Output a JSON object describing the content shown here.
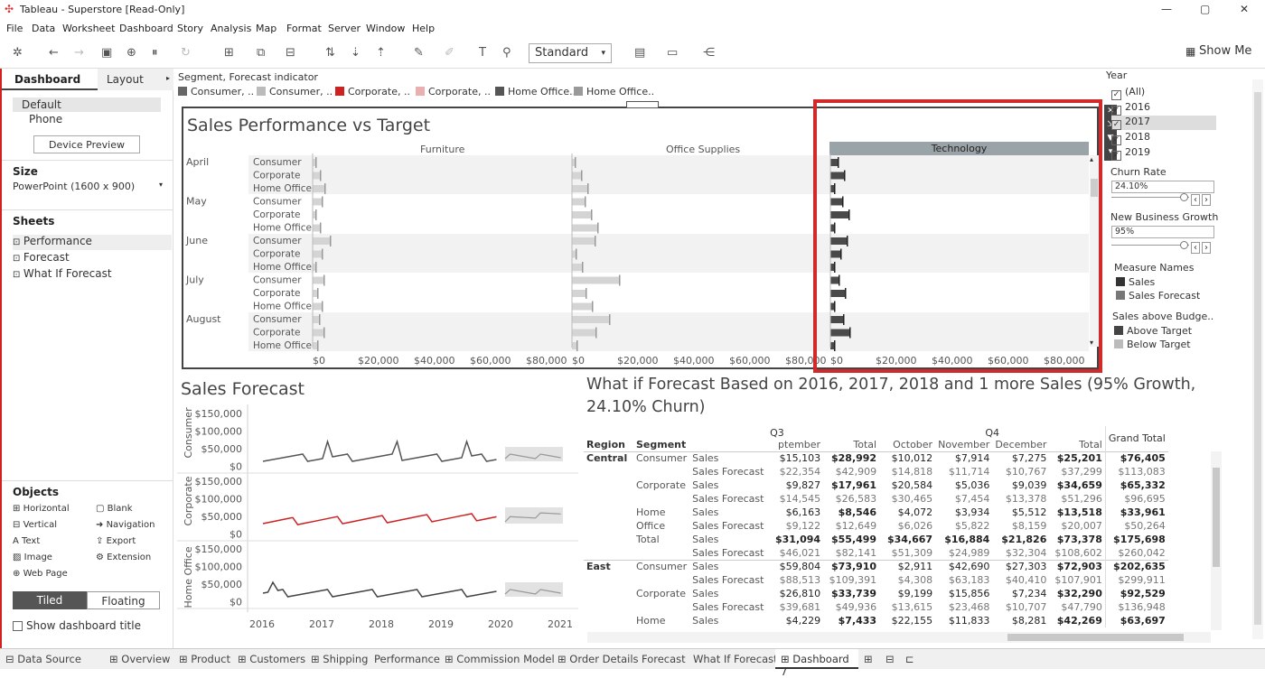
{
  "window": {
    "title": "Tableau - Superstore [Read-Only]"
  },
  "menu": [
    "File",
    "Data",
    "Worksheet",
    "Dashboard",
    "Story",
    "Analysis",
    "Map",
    "Format",
    "Server",
    "Window",
    "Help"
  ],
  "toolbar": {
    "fit": "Standard",
    "show_me": "Show Me"
  },
  "left": {
    "tab_dashboard": "Dashboard",
    "tab_layout": "Layout",
    "device_default": "Default",
    "device_phone": "Phone",
    "device_preview": "Device Preview",
    "size_header": "Size",
    "size_value": "PowerPoint (1600 x 900)",
    "sheets_header": "Sheets",
    "sheets": [
      "Performance",
      "Forecast",
      "What If Forecast"
    ],
    "objects_header": "Objects",
    "objects": [
      "Horizontal",
      "Blank",
      "Vertical",
      "Navigation",
      "Text",
      "Export",
      "Image",
      "Extension",
      "Web Page"
    ],
    "tiled": "Tiled",
    "floating": "Floating",
    "show_title": "Show dashboard title"
  },
  "legend_top": {
    "title": "Segment, Forecast indicator",
    "items": [
      "Consumer, ..",
      "Consumer, ..",
      "Corporate, ..",
      "Corporate, ..",
      "Home Office..",
      "Home Office.."
    ],
    "colors": [
      "#666666",
      "#bbbbbb",
      "#cc2222",
      "#e8b0b0",
      "#555555",
      "#999999"
    ]
  },
  "perf": {
    "title": "Sales Performance vs Target",
    "categories": [
      "Furniture",
      "Office Supplies",
      "Technology"
    ],
    "months": [
      "April",
      "May",
      "June",
      "July",
      "August"
    ],
    "segments": [
      "Consumer",
      "Corporate",
      "Home Office"
    ],
    "ticks": [
      "$0",
      "$20,000",
      "$40,000",
      "$60,000",
      "$80,000"
    ]
  },
  "forecast": {
    "title": "Sales Forecast",
    "rows": [
      "Consumer",
      "Corporate",
      "Home Office"
    ],
    "yticks": [
      "$150,000",
      "$100,000",
      "$50,000",
      "$0"
    ],
    "years": [
      "2016",
      "2017",
      "2018",
      "2019",
      "2020",
      "2021"
    ]
  },
  "whatif": {
    "title1": "What if Forecast Based on 2016, 2017, 2018 and 1 more Sales (95% Growth,",
    "title2": "24.10% Churn)",
    "q3": "Q3",
    "q4": "Q4",
    "grand_total": "Grand Total",
    "h_region": "Region",
    "h_segment": "Segment",
    "cols": [
      "ptember",
      "Total",
      "October",
      "November",
      "December",
      "Total"
    ],
    "rows": [
      [
        "Central",
        "Consumer",
        "Sales",
        "$15,103",
        "$28,992",
        "$10,012",
        "$7,914",
        "$7,275",
        "$25,201",
        "$76,405"
      ],
      [
        "",
        "",
        "Sales Forecast",
        "$22,354",
        "$42,909",
        "$14,818",
        "$11,714",
        "$10,767",
        "$37,299",
        "$113,083"
      ],
      [
        "",
        "Corporate",
        "Sales",
        "$9,827",
        "$17,961",
        "$20,584",
        "$5,036",
        "$9,039",
        "$34,659",
        "$65,332"
      ],
      [
        "",
        "",
        "Sales Forecast",
        "$14,545",
        "$26,583",
        "$30,465",
        "$7,454",
        "$13,378",
        "$51,296",
        "$96,695"
      ],
      [
        "",
        "Home",
        "Sales",
        "$6,163",
        "$8,546",
        "$4,072",
        "$3,934",
        "$5,512",
        "$13,518",
        "$33,961"
      ],
      [
        "",
        "Office",
        "Sales Forecast",
        "$9,122",
        "$12,649",
        "$6,026",
        "$5,822",
        "$8,159",
        "$20,007",
        "$50,264"
      ],
      [
        "",
        "Total",
        "Sales",
        "$31,094",
        "$55,499",
        "$34,667",
        "$16,884",
        "$21,826",
        "$73,378",
        "$175,698"
      ],
      [
        "",
        "",
        "Sales Forecast",
        "$46,021",
        "$82,141",
        "$51,309",
        "$24,989",
        "$32,304",
        "$108,602",
        "$260,042"
      ],
      [
        "East",
        "Consumer",
        "Sales",
        "$59,804",
        "$73,910",
        "$2,911",
        "$42,690",
        "$27,303",
        "$72,903",
        "$202,635"
      ],
      [
        "",
        "",
        "Sales Forecast",
        "$88,513",
        "$109,391",
        "$4,308",
        "$63,183",
        "$40,410",
        "$107,901",
        "$299,911"
      ],
      [
        "",
        "Corporate",
        "Sales",
        "$26,810",
        "$33,739",
        "$9,199",
        "$15,856",
        "$7,234",
        "$32,290",
        "$92,529"
      ],
      [
        "",
        "",
        "Sales Forecast",
        "$39,681",
        "$49,936",
        "$13,615",
        "$23,468",
        "$10,707",
        "$47,790",
        "$136,948"
      ],
      [
        "",
        "Home",
        "Sales",
        "$4,229",
        "$7,433",
        "$22,155",
        "$11,833",
        "$8,281",
        "$42,269",
        "$63,697"
      ]
    ]
  },
  "right": {
    "year_title": "Year",
    "years": [
      "(All)",
      "2016",
      "2017",
      "2018",
      "2019"
    ],
    "churn_title": "Churn Rate",
    "churn": "24.10%",
    "growth_title": "New Business Growth",
    "growth": "95%",
    "measure_title": "Measure Names",
    "measures": [
      "Sales",
      "Sales Forecast"
    ],
    "budget_title": "Sales above Budge..",
    "budget": [
      "Above Target",
      "Below Target"
    ]
  },
  "tabs": [
    "Data Source",
    "Overview",
    "Product",
    "Customers",
    "Shipping",
    "Performance",
    "Commission Model",
    "Order Details",
    "Forecast",
    "What If Forecast",
    "Dashboard 7"
  ]
}
